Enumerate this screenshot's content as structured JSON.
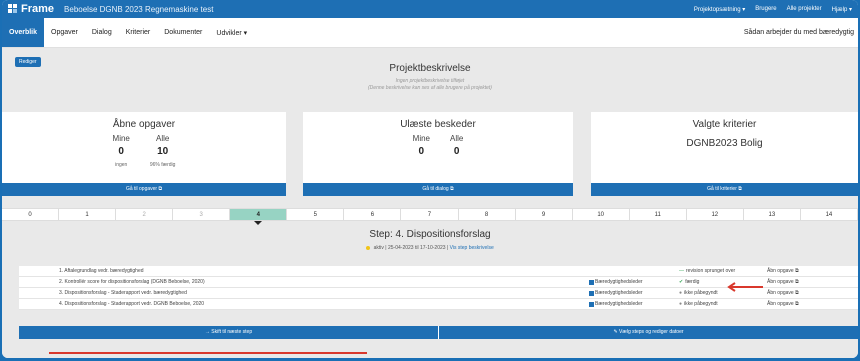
{
  "app": {
    "name": "Frame",
    "project": "Beboelse DGNB 2023 Regnemaskine test"
  },
  "topnav": [
    "Projektopsætning ▾",
    "Brugere",
    "Alle projekter",
    "Hjælp ▾"
  ],
  "tabs": [
    {
      "label": "Overblik",
      "active": true
    },
    {
      "label": "Opgaver"
    },
    {
      "label": "Dialog"
    },
    {
      "label": "Kriterier"
    },
    {
      "label": "Dokumenter"
    },
    {
      "label": "Udvikler ▾"
    }
  ],
  "help_text": "Sådan arbejder du med bæredygtig",
  "edit_button": "Rediger",
  "project_desc": {
    "title": "Projektbeskrivelse",
    "line1": "Ingen projektbeskrivelse tilføjet",
    "line2": "(Denne beskrivelse kan ses af alle brugere på projektet)"
  },
  "card_tasks": {
    "title": "Åbne opgaver",
    "mine_label": "Mine",
    "alle_label": "Alle",
    "mine_value": "0",
    "alle_value": "10",
    "mine_small": "ingen",
    "alle_small": "96% færdig",
    "cta": "Gå til opgaver ⧉"
  },
  "card_messages": {
    "title": "Ulæste beskeder",
    "mine_label": "Mine",
    "alle_label": "Alle",
    "mine_value": "0",
    "alle_value": "0",
    "cta": "Gå til dialog ⧉"
  },
  "card_criteria": {
    "title": "Valgte kriterier",
    "value": "DGNB2023 Bolig",
    "cta": "Gå til kriterier ⧉"
  },
  "steps": [
    "0",
    "1",
    "2",
    "3",
    "4",
    "5",
    "6",
    "7",
    "8",
    "9",
    "10",
    "11",
    "12",
    "13",
    "14"
  ],
  "active_step": "4",
  "step": {
    "title": "Step: 4. Dispositionsforslag",
    "status": "aktiv | 25-04-2023 til 17-10-2023 |",
    "link": "Vis step beskrivelse"
  },
  "tasks": [
    {
      "name": "1. Aftalegrundlag vedr. bæredygtighed",
      "role": "",
      "status": "revision sprunget over",
      "status_icon": "—",
      "status_color": "green",
      "open": "Åbn opgave ⧉"
    },
    {
      "name": "2. Kontrollér score for dispositionsforslag (DGNB Beboelse, 2020)",
      "role": "Bæredygtighedsleder",
      "status": "færdig",
      "status_icon": "✔",
      "status_color": "green",
      "open": "Åbn opgave ⧉"
    },
    {
      "name": "3. Dispositionsforslag - Staderapport vedr. bæredygtighed",
      "role": "Bæredygtighedsleder",
      "status": "ikke påbegyndt",
      "status_icon": "●",
      "status_color": "gray",
      "open": "Åbn opgave ⧉"
    },
    {
      "name": "4. Dispositionsforslag - Staderapport vedr. DGNB Beboelse, 2020",
      "role": "Bæredygtighedsleder",
      "status": "ikke påbegyndt",
      "status_icon": "●",
      "status_color": "gray",
      "open": "Åbn opgave ⧉"
    }
  ],
  "buttons": {
    "next_step": "→ Skift til næste step",
    "choose_steps": "✎ Vælg steps og rediger datoer"
  },
  "colors": {
    "primary": "#1e6fb4",
    "active_step": "#97d3c3",
    "annotation": "#d9382c"
  }
}
